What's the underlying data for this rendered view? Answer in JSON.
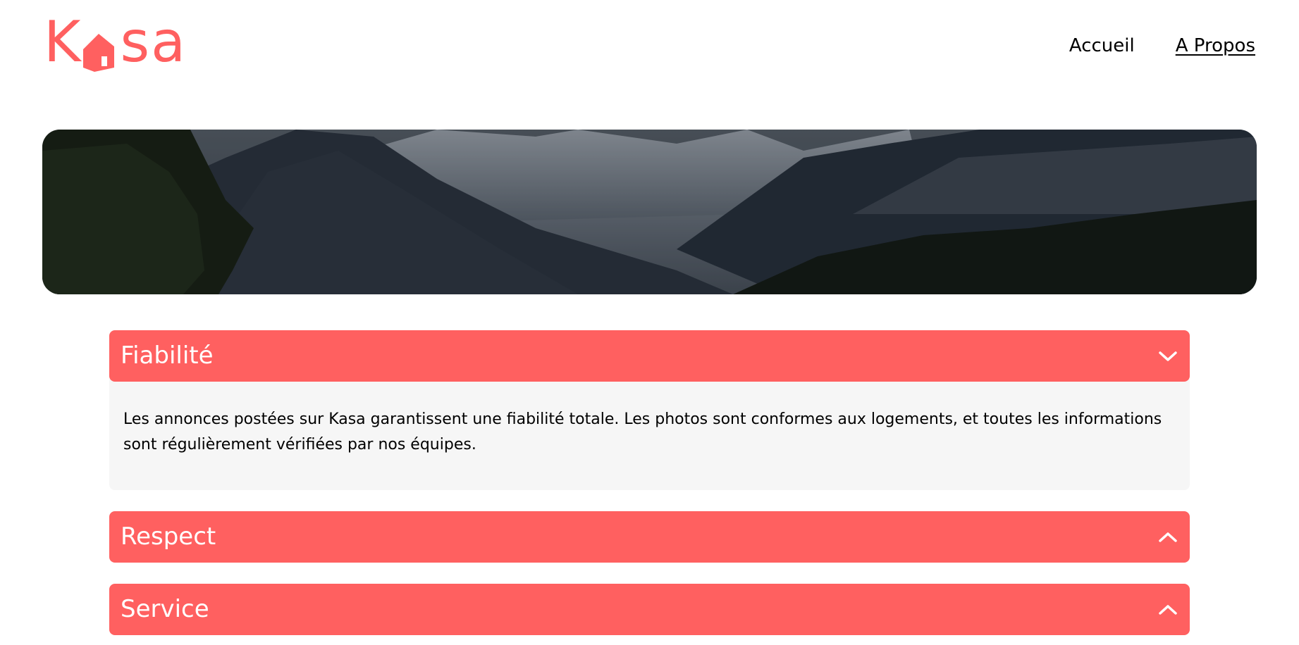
{
  "brand": {
    "logo_k": "K",
    "logo_sa": "sa",
    "accent_color": "#ff6060"
  },
  "nav": {
    "items": [
      {
        "label": "Accueil",
        "active": false
      },
      {
        "label": "A Propos",
        "active": true
      }
    ]
  },
  "banner": {
    "image": "mountain-landscape"
  },
  "collapses": [
    {
      "title": "Fiabilité",
      "open": true,
      "icon": "chevron-down-icon",
      "content": "Les annonces postées sur Kasa garantissent une fiabilité totale. Les photos sont conformes aux logements, et toutes les informations sont régulièrement vérifiées par nos équipes."
    },
    {
      "title": "Respect",
      "open": false,
      "icon": "chevron-up-icon"
    },
    {
      "title": "Service",
      "open": false,
      "icon": "chevron-up-icon"
    }
  ]
}
